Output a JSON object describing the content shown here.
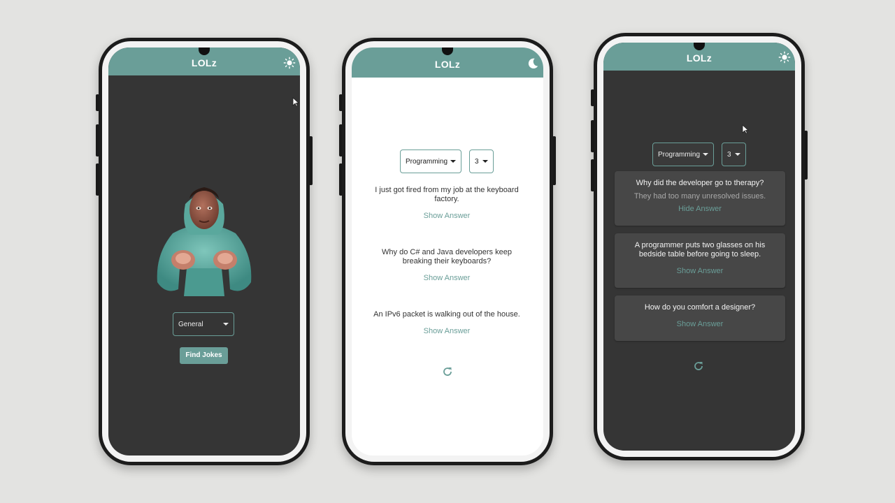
{
  "app": {
    "title": "LOLz"
  },
  "colors": {
    "primary": "#6a9e98",
    "dark_bg": "#353535",
    "card_bg": "#474747",
    "light_bg": "#ffffff"
  },
  "screen1": {
    "category": "General",
    "find_button": "Find Jokes",
    "theme_icon": "sun-icon"
  },
  "screen2": {
    "category": "Programming",
    "count": "3",
    "theme_icon": "moon-icon",
    "jokes": [
      {
        "setup": "I just got fired from my job at the keyboard factory.",
        "toggle": "Show Answer"
      },
      {
        "setup": "Why do C# and Java developers keep breaking their keyboards?",
        "toggle": "Show Answer"
      },
      {
        "setup": "An IPv6 packet is walking out of the house.",
        "toggle": "Show Answer"
      }
    ]
  },
  "screen3": {
    "category": "Programming",
    "count": "3",
    "theme_icon": "sun-icon",
    "jokes": [
      {
        "setup": "Why did the developer go to therapy?",
        "punchline": "They had too many unresolved issues.",
        "toggle": "Hide Answer"
      },
      {
        "setup": "A programmer puts two glasses on his bedside table before going to sleep.",
        "toggle": "Show Answer"
      },
      {
        "setup": "How do you comfort a designer?",
        "toggle": "Show Answer"
      }
    ]
  }
}
